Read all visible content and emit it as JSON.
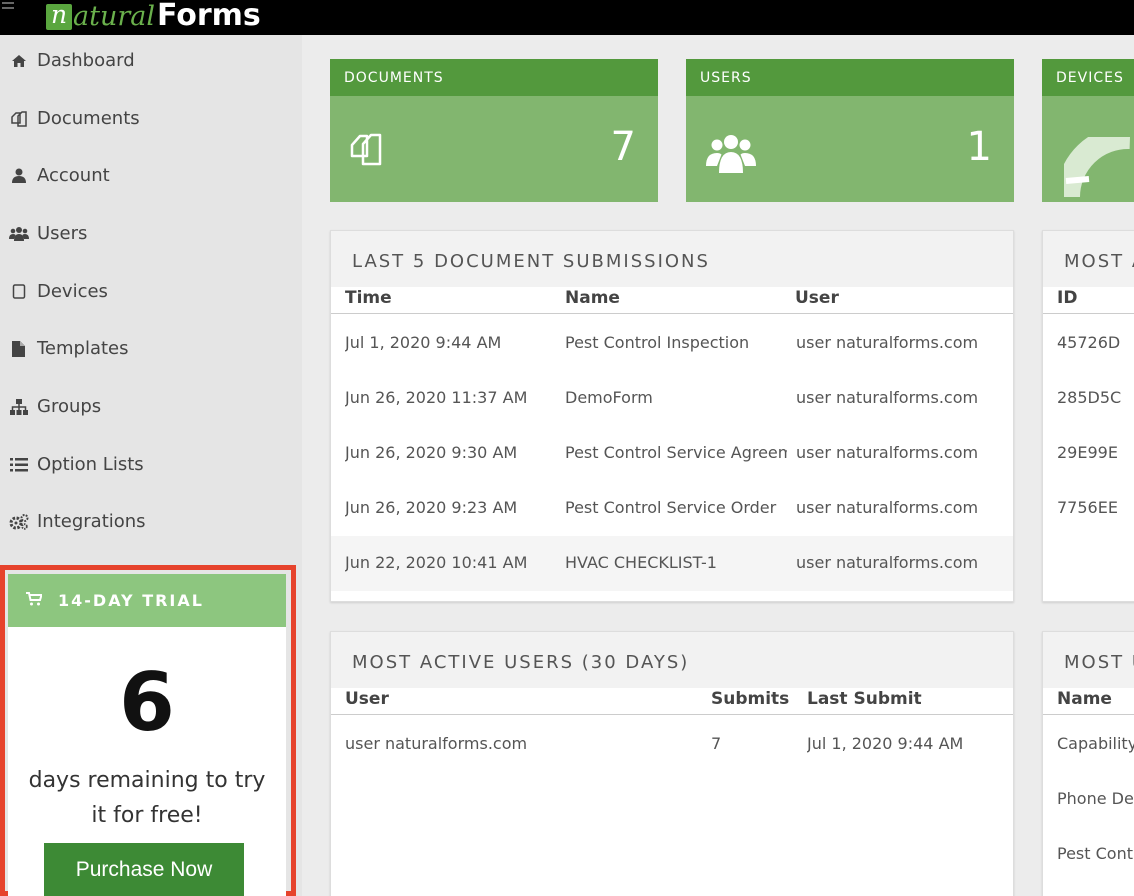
{
  "app": {
    "logo_n": "n",
    "logo_natural": "atural",
    "logo_forms": "Forms"
  },
  "sidebar": {
    "items": [
      {
        "label": "Dashboard",
        "icon": "home-icon"
      },
      {
        "label": "Documents",
        "icon": "documents-icon"
      },
      {
        "label": "Account",
        "icon": "user-icon"
      },
      {
        "label": "Users",
        "icon": "users-icon"
      },
      {
        "label": "Devices",
        "icon": "tablet-icon"
      },
      {
        "label": "Templates",
        "icon": "file-icon"
      },
      {
        "label": "Groups",
        "icon": "sitemap-icon"
      },
      {
        "label": "Option Lists",
        "icon": "list-icon"
      },
      {
        "label": "Integrations",
        "icon": "cogs-icon"
      }
    ]
  },
  "trial": {
    "title": "14-DAY TRIAL",
    "days": "6",
    "message": "days remaining to try it for free!",
    "button": "Purchase Now"
  },
  "stats": {
    "documents": {
      "label": "DOCUMENTS",
      "value": "7"
    },
    "users": {
      "label": "USERS",
      "value": "1"
    },
    "devices": {
      "label": "DEVICES"
    }
  },
  "submissions": {
    "title": "LAST 5 DOCUMENT SUBMISSIONS",
    "columns": [
      "Time",
      "Name",
      "User"
    ],
    "rows": [
      {
        "time": "Jul 1, 2020 9:44 AM",
        "name": "Pest Control Inspection",
        "user": "user naturalforms.com"
      },
      {
        "time": "Jun 26, 2020 11:37 AM",
        "name": "DemoForm",
        "user": "user naturalforms.com"
      },
      {
        "time": "Jun 26, 2020 9:30 AM",
        "name": "Pest Control Service Agreement",
        "user": "user naturalforms.com"
      },
      {
        "time": "Jun 26, 2020 9:23 AM",
        "name": "Pest Control Service Order",
        "user": "user naturalforms.com"
      },
      {
        "time": "Jun 22, 2020 10:41 AM",
        "name": "HVAC CHECKLIST-1",
        "user": "user naturalforms.com"
      }
    ]
  },
  "active_devices": {
    "title": "MOST A",
    "column": "ID",
    "rows": [
      "45726D",
      "285D5C",
      "29E99E",
      "7756EE"
    ]
  },
  "active_users": {
    "title": "MOST ACTIVE USERS (30 DAYS)",
    "columns": [
      "User",
      "Submits",
      "Last Submit"
    ],
    "rows": [
      {
        "user": "user naturalforms.com",
        "submits": "7",
        "last": "Jul 1, 2020 9:44 AM"
      }
    ]
  },
  "used_templates": {
    "title": "MOST U",
    "column": "Name",
    "rows": [
      "Capability",
      "Phone Der",
      "Pest Contr"
    ]
  }
}
